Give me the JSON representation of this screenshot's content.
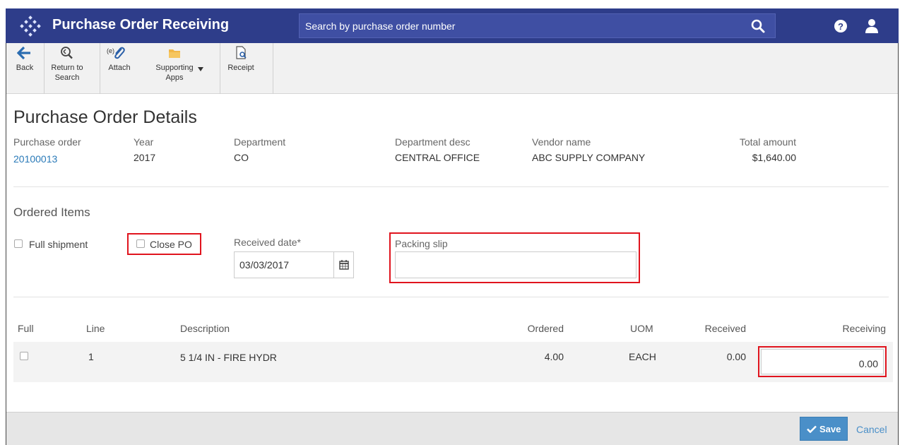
{
  "app": {
    "title": "Purchase Order Receiving"
  },
  "search": {
    "placeholder": "Search by purchase order number"
  },
  "toolbar": {
    "back": "Back",
    "return_line1": "Return to",
    "return_line2": "Search",
    "attach_prefix": "(e)",
    "attach": "Attach",
    "supporting_line1": "Supporting",
    "supporting_line2": "Apps",
    "receipt": "Receipt"
  },
  "details": {
    "title": "Purchase Order Details",
    "fields": [
      {
        "label": "Purchase order",
        "value": "20100013"
      },
      {
        "label": "Year",
        "value": "2017"
      },
      {
        "label": "Department",
        "value": "CO"
      },
      {
        "label": "Department desc",
        "value": "CENTRAL OFFICE"
      },
      {
        "label": "Vendor name",
        "value": "ABC SUPPLY COMPANY"
      },
      {
        "label": "Total amount",
        "value": "$1,640.00"
      }
    ]
  },
  "ordered_items": {
    "title": "Ordered Items",
    "full_shipment": "Full shipment",
    "close_po": "Close PO",
    "received_date_label": "Received date*",
    "received_date_value": "03/03/2017",
    "packing_slip_label": "Packing slip",
    "packing_slip_value": ""
  },
  "table": {
    "columns": [
      "Full",
      "Line",
      "Description",
      "Ordered",
      "UOM",
      "Received",
      "Receiving"
    ],
    "rows": [
      {
        "line": "1",
        "description": "5 1/4 IN - FIRE HYDR",
        "ordered": "4.00",
        "uom": "EACH",
        "received": "0.00",
        "receiving": "0.00"
      }
    ]
  },
  "footer": {
    "save": "Save",
    "cancel": "Cancel"
  },
  "colors": {
    "header": "#2e3d8a",
    "link": "#2a7ab8",
    "highlight": "#e0141e",
    "save": "#4a8fc8"
  }
}
